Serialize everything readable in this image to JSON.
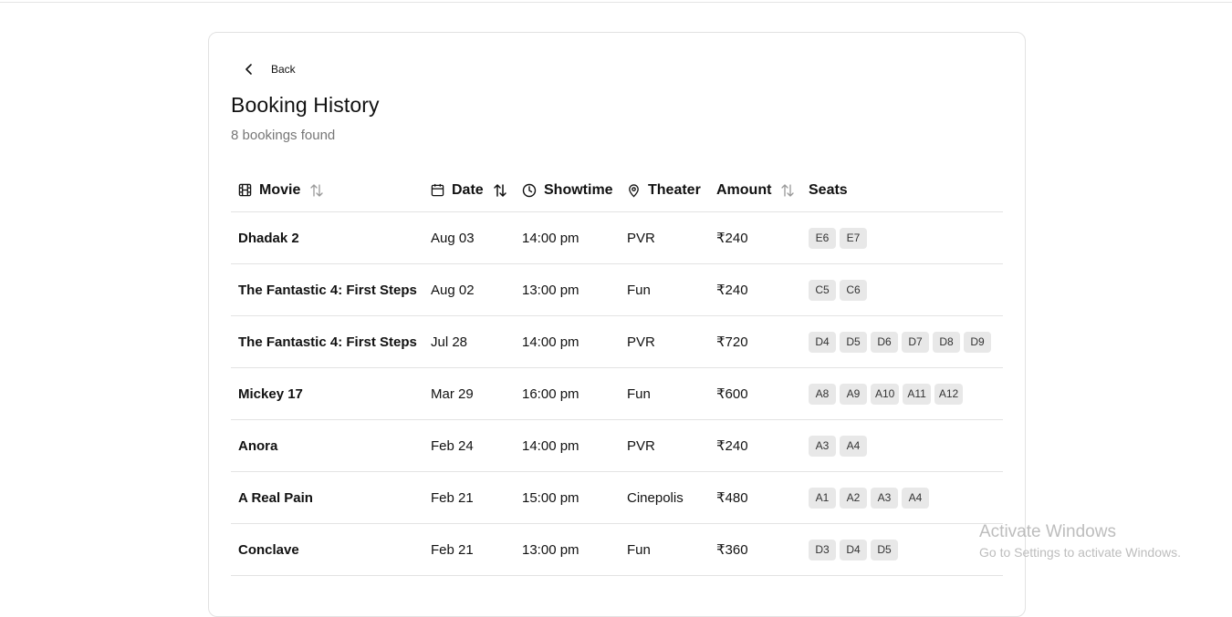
{
  "nav": {
    "back_label": "Back"
  },
  "page": {
    "title": "Booking History",
    "subtitle": "8 bookings found"
  },
  "table": {
    "columns": {
      "movie": "Movie",
      "date": "Date",
      "showtime": "Showtime",
      "theater": "Theater",
      "amount": "Amount",
      "seats": "Seats"
    },
    "rows": [
      {
        "movie": "Dhadak 2",
        "date": "Aug 03",
        "showtime": "14:00 pm",
        "theater": "PVR",
        "amount": "₹240",
        "seats": [
          "E6",
          "E7"
        ]
      },
      {
        "movie": "The Fantastic 4: First Steps",
        "date": "Aug 02",
        "showtime": "13:00 pm",
        "theater": "Fun",
        "amount": "₹240",
        "seats": [
          "C5",
          "C6"
        ]
      },
      {
        "movie": "The Fantastic 4: First Steps",
        "date": "Jul 28",
        "showtime": "14:00 pm",
        "theater": "PVR",
        "amount": "₹720",
        "seats": [
          "D4",
          "D5",
          "D6",
          "D7",
          "D8",
          "D9"
        ]
      },
      {
        "movie": "Mickey 17",
        "date": "Mar 29",
        "showtime": "16:00 pm",
        "theater": "Fun",
        "amount": "₹600",
        "seats": [
          "A8",
          "A9",
          "A10",
          "A11",
          "A12"
        ]
      },
      {
        "movie": "Anora",
        "date": "Feb 24",
        "showtime": "14:00 pm",
        "theater": "PVR",
        "amount": "₹240",
        "seats": [
          "A3",
          "A4"
        ]
      },
      {
        "movie": "A Real Pain",
        "date": "Feb 21",
        "showtime": "15:00 pm",
        "theater": "Cinepolis",
        "amount": "₹480",
        "seats": [
          "A1",
          "A2",
          "A3",
          "A4"
        ]
      },
      {
        "movie": "Conclave",
        "date": "Feb 21",
        "showtime": "13:00 pm",
        "theater": "Fun",
        "amount": "₹360",
        "seats": [
          "D3",
          "D4",
          "D5"
        ]
      }
    ]
  },
  "watermark": {
    "line1": "Activate Windows",
    "line2": "Go to Settings to activate Windows."
  },
  "colors": {
    "text": "#111111",
    "muted": "#777777",
    "border": "#e3e3e3",
    "seat_bg": "#e8e8e8"
  },
  "icons": [
    "chevron-left-icon",
    "film-icon",
    "calendar-icon",
    "clock-icon",
    "map-pin-icon",
    "sort-icon"
  ]
}
